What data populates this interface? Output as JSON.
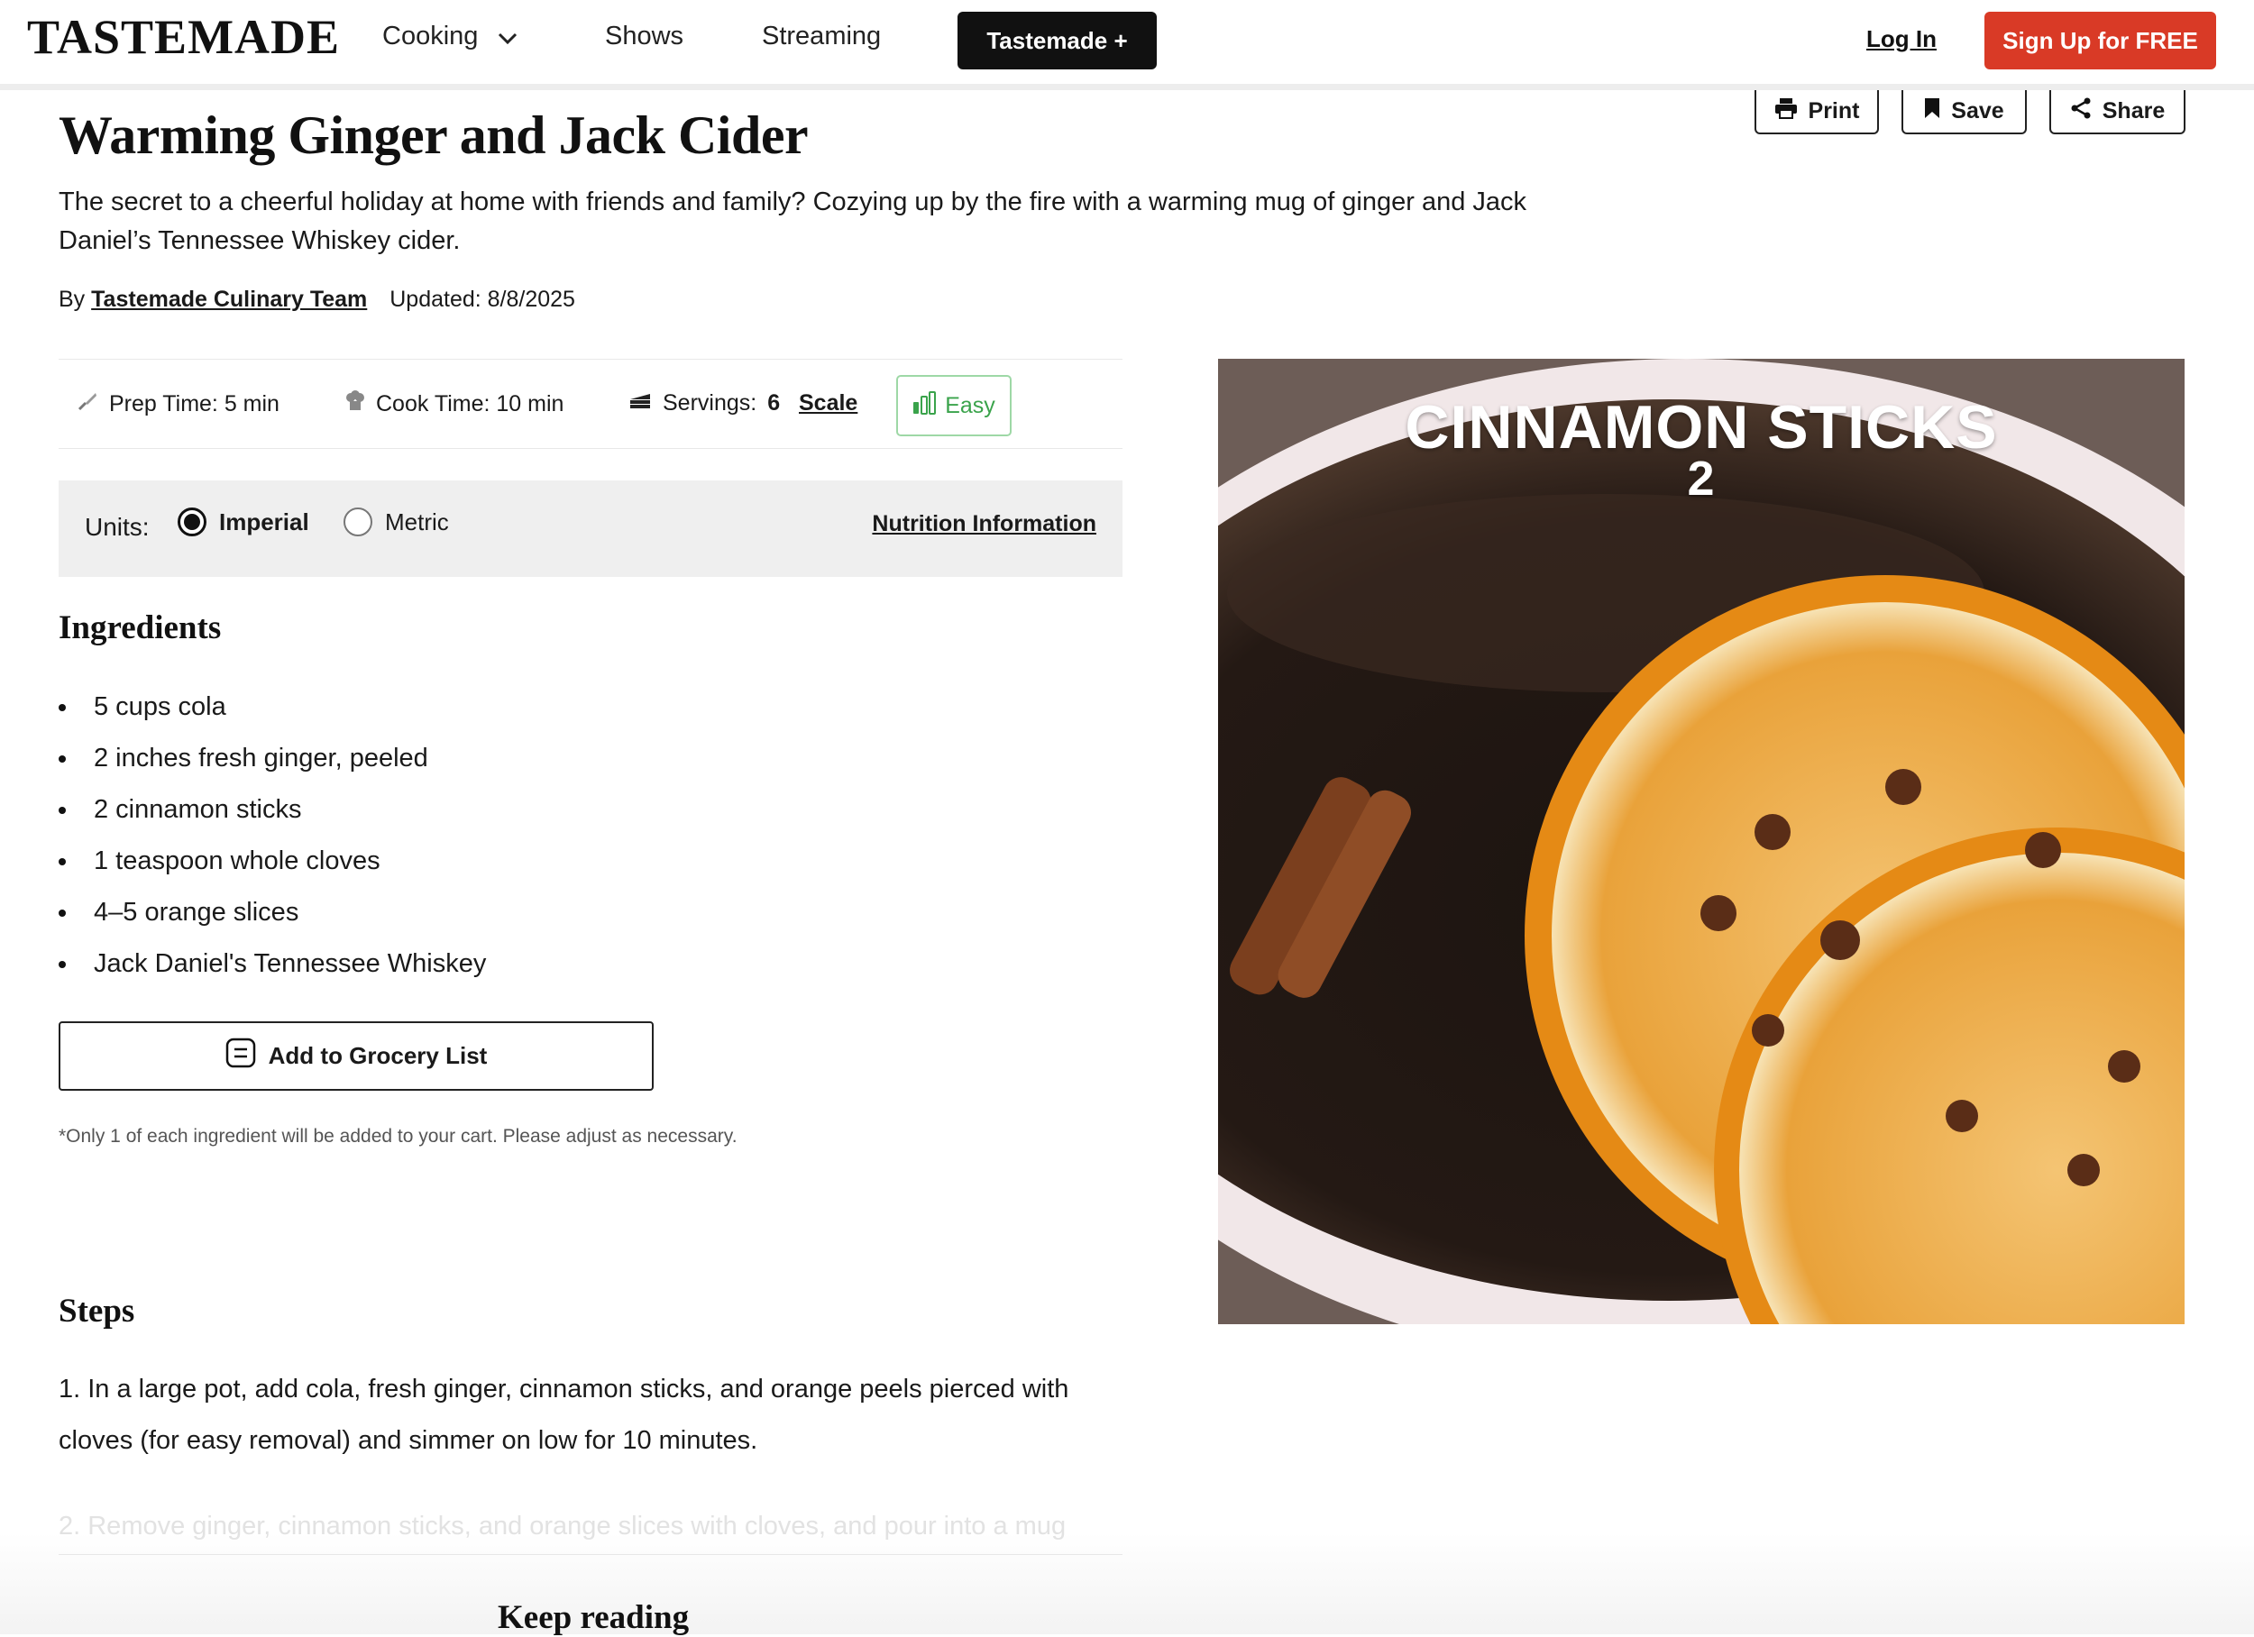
{
  "header": {
    "logo": "TASTEMADE",
    "nav": {
      "cooking": "Cooking",
      "shows": "Shows",
      "streaming": "Streaming"
    },
    "plus_button": "Tastemade +",
    "login": "Log In",
    "signup": "Sign Up for FREE"
  },
  "actions": {
    "print": "Print",
    "save": "Save",
    "share": "Share"
  },
  "recipe": {
    "title": "Warming Ginger and Jack Cider",
    "description": "The secret to a cheerful holiday at home with friends and family? Cozying up by the fire with a warming mug of ginger and Jack Daniel’s Tennessee Whiskey cider.",
    "by": "By",
    "author": "Tastemade Culinary Team",
    "updated": "Updated: 8/8/2025"
  },
  "stats": {
    "prep": "Prep Time: 5 min",
    "cook": "Cook Time: 10 min",
    "servings_label": "Servings:",
    "servings_value": "6",
    "scale": "Scale",
    "difficulty": "Easy"
  },
  "units": {
    "label": "Units:",
    "options": [
      "Imperial",
      "Metric"
    ],
    "selected": "Imperial",
    "nutrition": "Nutrition Information"
  },
  "ingredients": {
    "heading": "Ingredients",
    "items": [
      "5 cups cola",
      "2 inches fresh ginger, peeled",
      "2 cinnamon sticks",
      "1 teaspoon whole cloves",
      "4–5 orange slices",
      "Jack Daniel's Tennessee Whiskey"
    ],
    "grocery_button": "Add to Grocery List",
    "note": "*Only 1 of each ingredient will be added to your cart. Please adjust as necessary."
  },
  "steps": {
    "heading": "Steps",
    "items": [
      "1. In a large pot, add cola, fresh ginger, cinnamon sticks, and orange peels pierced with cloves (for easy removal) and simmer on low for 10 minutes.",
      "2. Remove ginger, cinnamon sticks, and orange slices with cloves, and pour into a mug"
    ],
    "keep_reading": "Keep reading"
  },
  "media": {
    "caption": "CINNAMON STICKS",
    "caption_count": "2"
  },
  "colors": {
    "brand_red": "#d93a26",
    "easy_green": "#3aa34b",
    "units_bg": "#efefef"
  }
}
